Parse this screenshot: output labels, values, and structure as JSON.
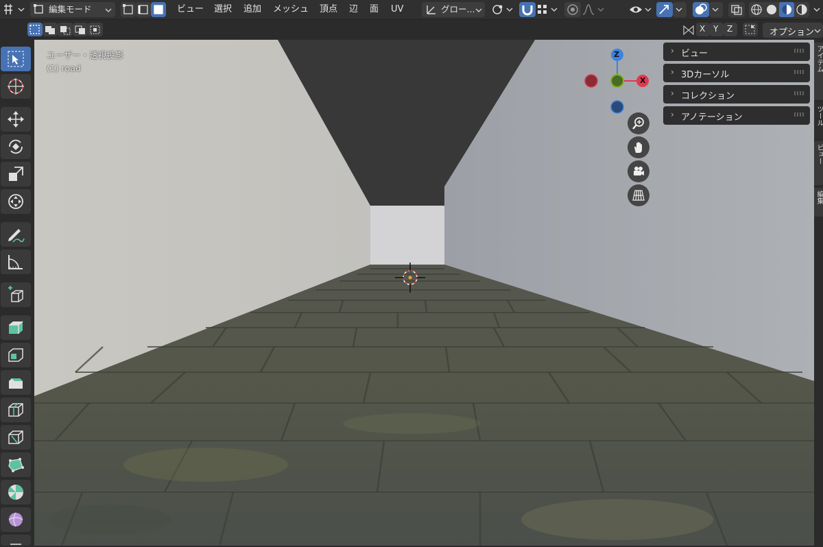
{
  "header": {
    "editor_mode": "編集モード",
    "menus": [
      "ビュー",
      "選択",
      "追加",
      "メッシュ",
      "頂点",
      "辺",
      "面",
      "UV"
    ],
    "transform_orientation": "グロー...",
    "options_label": "オプション",
    "axis_x": "X",
    "axis_y": "Y",
    "axis_z": "Z"
  },
  "viewport": {
    "view_name": "ユーザー・透視投影",
    "object_name": "(1) road"
  },
  "gizmo": {
    "z_label": "Z",
    "x_label": "X"
  },
  "sidebar_panels": [
    {
      "label": "ビュー"
    },
    {
      "label": "3Dカーソル"
    },
    {
      "label": "コレクション"
    },
    {
      "label": "アノテーション"
    }
  ],
  "side_tabs": [
    "アイテム",
    "ツール",
    "ビュー",
    "編集"
  ],
  "colors": {
    "accent": "#4772b3",
    "axis_x": "#e0394f",
    "axis_y": "#7fb32c",
    "axis_z": "#3b83e0"
  },
  "tools": [
    "select-box-icon",
    "cursor-icon",
    "move-icon",
    "rotate-icon",
    "scale-icon",
    "transform-icon",
    "annotate-icon",
    "measure-icon",
    "add-cube-icon",
    "extrude-icon",
    "inset-icon",
    "bevel-icon",
    "loop-cut-icon",
    "knife-icon",
    "poly-build-icon",
    "spin-icon",
    "smooth-icon"
  ]
}
